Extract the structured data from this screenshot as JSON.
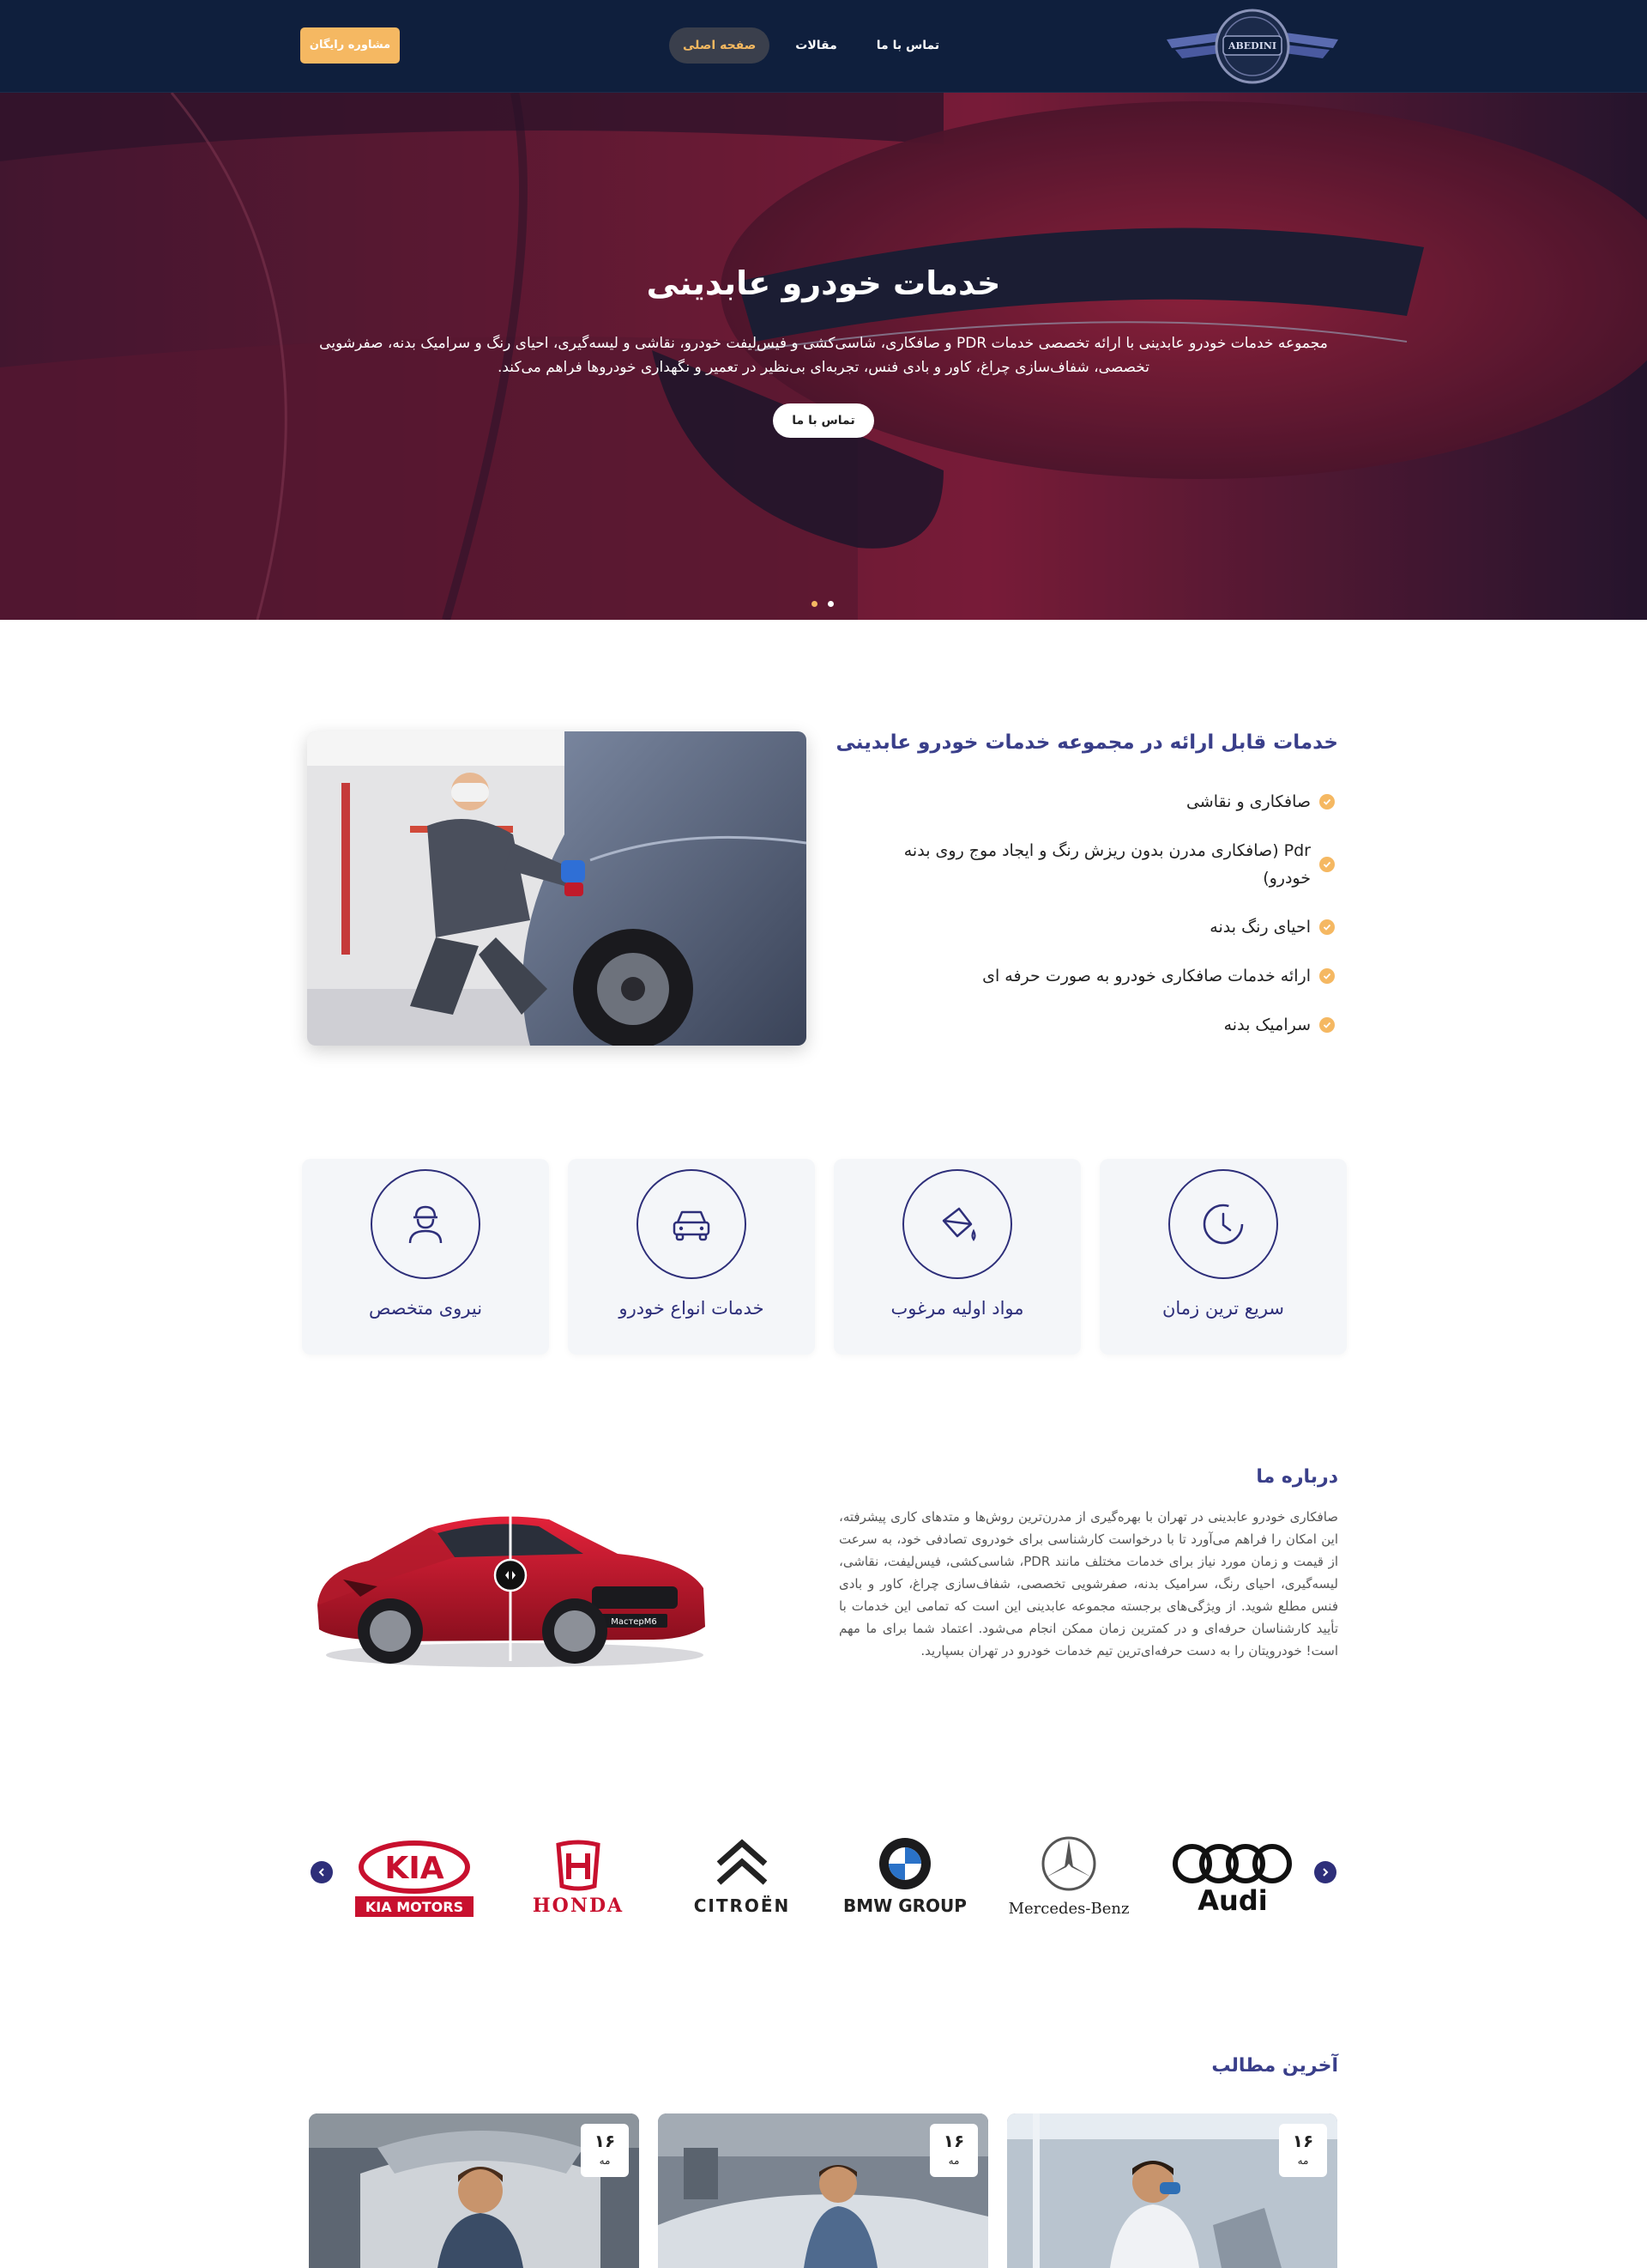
{
  "header": {
    "logo_text": "ABEDINI",
    "nav": [
      {
        "label": "صفحه اصلی",
        "active": true
      },
      {
        "label": "مقالات",
        "active": false
      },
      {
        "label": "تماس با ما",
        "active": false
      }
    ],
    "cta_label": "مشاوره رایگان"
  },
  "hero": {
    "title": "خدمات خودرو عابدینی",
    "description": "مجموعه خدمات خودرو عابدینی با ارائه تخصصی خدمات PDR و صافکاری، شاسی‌کشی و فیس‌لیفت خودرو، نقاشی و لیسه‌گیری، احیای رنگ و سرامیک بدنه، صفرشویی تخصصی، شفاف‌سازی چراغ، کاور و بادی فنس، تجربه‌ای بی‌نظیر در تعمیر و نگهداری خودروها فراهم می‌کند.",
    "button_label": "تماس با ما",
    "slides": 2,
    "active_slide": 1
  },
  "services": {
    "title": "خدمات قابل ارائه در مجموعه خدمات خودرو عابدینی",
    "items": [
      "صافکاری و نقاشی",
      "Pdr (صافکاری مدرن بدون ریزش رنگ و ایجاد موج روی بدنه خودرو)",
      "احیای رنگ بدنه",
      "ارائه خدمات صافکاری خودرو به صورت حرفه ای",
      "سرامیک بدنه"
    ]
  },
  "features": [
    {
      "label": "نیروی متخصص",
      "icon": "technician-icon"
    },
    {
      "label": "خدمات انواع خودرو",
      "icon": "car-icon"
    },
    {
      "label": "مواد اولیه مرغوب",
      "icon": "paint-bucket-icon"
    },
    {
      "label": "سریع ترین زمان",
      "icon": "clock-icon"
    }
  ],
  "about": {
    "title": "درباره ما",
    "text": "صافکاری خودرو عابدینی در تهران با بهره‌گیری از مدرن‌ترین روش‌ها و متدهای کاری پیشرفته، این امکان را فراهم می‌آورد تا با درخواست کارشناسی برای خودروی تصادفی خود، به سرعت از قیمت و زمان مورد نیاز برای خدمات مختلف مانند PDR، شاسی‌کشی، فیس‌لیفت، نقاشی، لیسه‌گیری، احیای رنگ، سرامیک بدنه، صفرشویی تخصصی، شفاف‌سازی چراغ، کاور و بادی فنس مطلع شوید. از ویژگی‌های برجسته مجموعه عابدینی این است که تمامی این خدمات با تأیید کارشناسان حرفه‌ای و در کمترین زمان ممکن انجام می‌شود. اعتماد شما برای ما مهم است! خودرویتان را به دست حرفه‌ای‌ترین تیم خدمات خودرو در تهران بسپارید.",
    "plate_text": "МастерМ6"
  },
  "brands": [
    {
      "name": "KIA MOTORS",
      "logo": "KIA",
      "color": "#c8102e"
    },
    {
      "name": "HONDA",
      "color": "#c8102e"
    },
    {
      "name": "CITROËN",
      "color": "#222222"
    },
    {
      "name": "BMW GROUP",
      "color": "#222222"
    },
    {
      "name": "Mercedes-Benz",
      "color": "#222222"
    },
    {
      "name": "Audi",
      "color": "#111111"
    }
  ],
  "latest": {
    "title": "آخرین مطالب",
    "posts": [
      {
        "day": "۱۶",
        "month": "مه"
      },
      {
        "day": "۱۶",
        "month": "مه"
      },
      {
        "day": "۱۶",
        "month": "مه"
      }
    ]
  },
  "colors": {
    "header_bg": "#0f1f3d",
    "accent": "#f5b862",
    "primary": "#2e2f7a",
    "title": "#3a3f8a"
  }
}
